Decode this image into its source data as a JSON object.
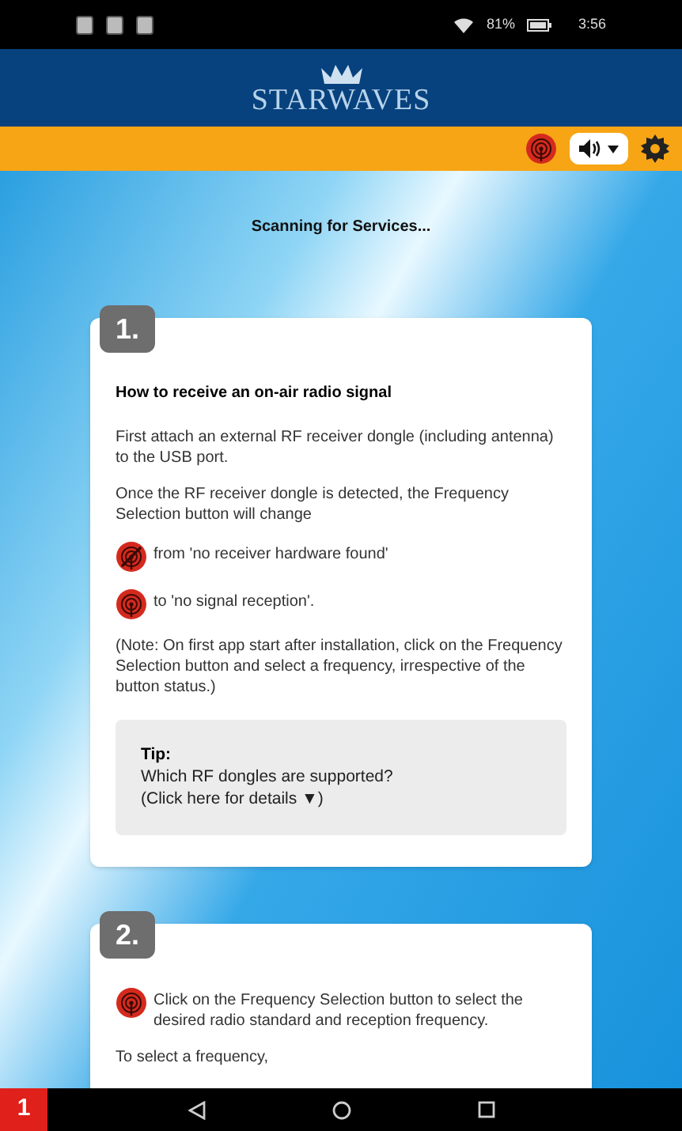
{
  "status_bar": {
    "battery": "81%",
    "time": "3:56"
  },
  "header": {
    "logo": "STARWAVES"
  },
  "scan_status": "Scanning for Services...",
  "cards": [
    {
      "number": "1.",
      "blocks": [
        {
          "kind": "heading",
          "text": "How to receive an on-air radio signal"
        },
        {
          "kind": "paragraph",
          "text": "First attach an external RF receiver dongle (including antenna) to the USB port."
        },
        {
          "kind": "paragraph",
          "text": "Once the RF receiver dongle is detected, the Frequency Selection button will change"
        },
        {
          "kind": "crossed_icon_line",
          "text": "from 'no receiver hardware found'"
        },
        {
          "kind": "icon_line",
          "text": "to 'no signal reception'."
        },
        {
          "kind": "paragraph",
          "text": "(Note: On first app start after installation, click on the Frequency Selection button and select a frequency, irrespective of the button status.)"
        },
        {
          "kind": "tip",
          "title": "Tip:",
          "lines": [
            "Which RF dongles are supported?",
            "(Click here for details ▼)"
          ]
        }
      ]
    },
    {
      "number": "2.",
      "blocks": [
        {
          "kind": "icon_line",
          "text": "Click on the Frequency Selection button to select the desired radio standard and reception frequency."
        },
        {
          "kind": "paragraph",
          "text": "To select a frequency,"
        }
      ]
    }
  ],
  "corner_badge": "1"
}
